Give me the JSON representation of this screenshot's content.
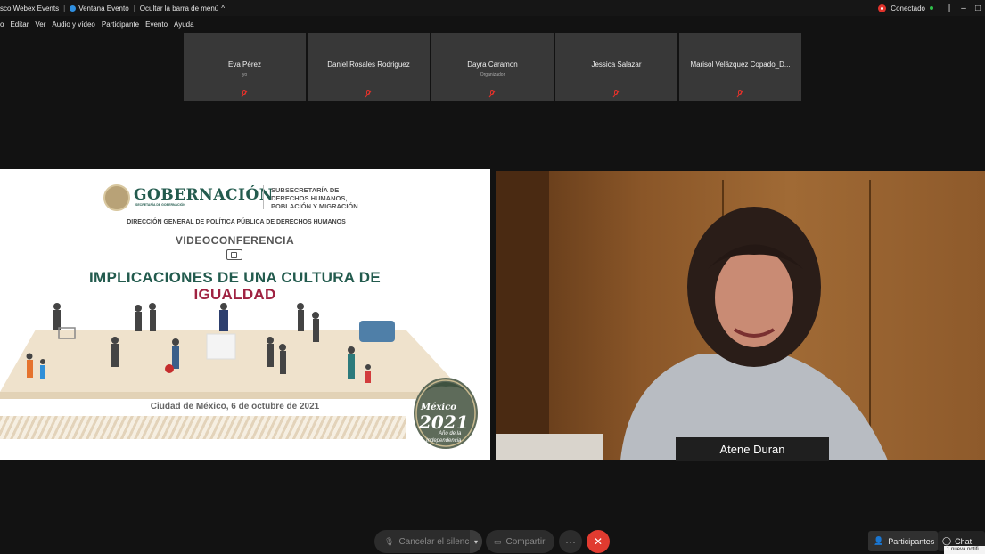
{
  "titlebar": {
    "app_name": "sco Webex Events",
    "window_label": "Ventana Evento",
    "hide_menu": "Ocultar la barra de menú",
    "status": "Conectado"
  },
  "menu": [
    "o",
    "Editar",
    "Ver",
    "Audio y vídeo",
    "Participante",
    "Evento",
    "Ayuda"
  ],
  "participants": [
    {
      "name": "Eva Pérez",
      "role": "yo"
    },
    {
      "name": "Daniel Rosales Rodriguez",
      "role": ""
    },
    {
      "name": "Dayra Caramon",
      "role": "Organizador"
    },
    {
      "name": "Jessica Salazar",
      "role": ""
    },
    {
      "name": "Marisol Velázquez Copado_D...",
      "role": ""
    }
  ],
  "slide": {
    "gob_title": "GOBERNACIÓN",
    "gob_sub": "SECRETARÍA DE GOBERNACIÓN",
    "subsecretaria": "SUBSECRETARÍA DE DERECHOS HUMANOS, POBLACIÓN Y MIGRACIÓN",
    "direccion": "DIRECCIÓN GENERAL DE POLÍTICA PÚBLICA DE DERECHOS HUMANOS",
    "videoconferencia": "VIDEOCONFERENCIA",
    "title_line1": "IMPLICACIONES DE UNA CULTURA DE",
    "title_line2": "IGUALDAD",
    "date": "Ciudad de México, 6 de octubre de 2021",
    "seal_mexico": "México",
    "seal_year": "2021",
    "seal_sub1": "Año de la",
    "seal_sub2": "Independencia"
  },
  "speaker": {
    "name": "Atene Duran"
  },
  "controls": {
    "mute": "Cancelar el silencio",
    "share": "Compartir",
    "more": "···",
    "leave": "✕",
    "participants": "Participantes",
    "chat": "Chat",
    "toast": "1 nueva notifi"
  },
  "colors": {
    "gob_green": "#235b4e",
    "gob_wine": "#9f2241",
    "leave_red": "#e13b30"
  }
}
